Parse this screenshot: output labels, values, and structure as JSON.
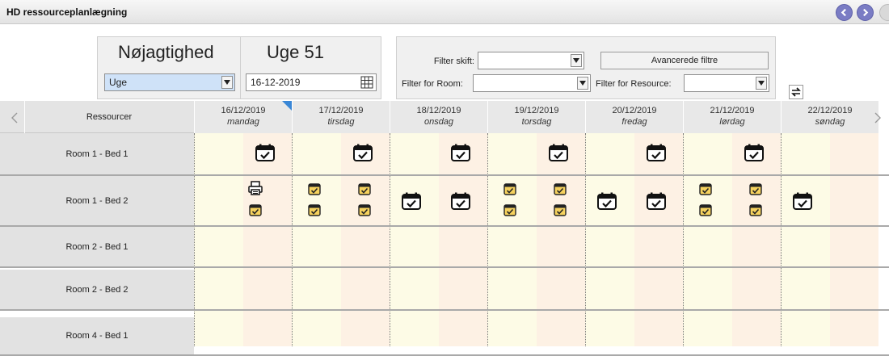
{
  "window": {
    "title": "HD ressourceplanlægning"
  },
  "toolbar": {
    "precision_title": "Nøjagtighed",
    "precision_value": "Uge",
    "week_title": "Uge 51",
    "date_value": "16-12-2019",
    "filter_shift_label": "Filter skift:",
    "filter_shift_value": "",
    "advanced_filters_label": "Avancerede filtre",
    "filter_room_label": "Filter for Room:",
    "filter_room_value": "",
    "filter_resource_label": "Filter for Resource:",
    "filter_resource_value": ""
  },
  "grid": {
    "resources_header": "Ressourcer",
    "days": [
      {
        "date": "16/12/2019",
        "weekday": "mandag"
      },
      {
        "date": "17/12/2019",
        "weekday": "tirsdag"
      },
      {
        "date": "18/12/2019",
        "weekday": "onsdag"
      },
      {
        "date": "19/12/2019",
        "weekday": "torsdag"
      },
      {
        "date": "20/12/2019",
        "weekday": "fredag"
      },
      {
        "date": "21/12/2019",
        "weekday": "lørdag"
      },
      {
        "date": "22/12/2019",
        "weekday": "søndag"
      }
    ],
    "rows": [
      {
        "label": "Room 1 - Bed 1"
      },
      {
        "label": "Room 1 - Bed 2"
      },
      {
        "label": "Room 2 - Bed 1"
      },
      {
        "label": "Room 2 - Bed 2"
      },
      {
        "label": "Room 4 - Bed 1"
      }
    ]
  },
  "colors": {
    "half_a": "#fdfbe6",
    "half_b": "#fdf1e4",
    "nav_button": "#7a7cc4"
  },
  "icons": {
    "shift_check": "calendar-check-icon",
    "small_check": "small-calendar-check-icon",
    "printer": "printer-icon"
  }
}
